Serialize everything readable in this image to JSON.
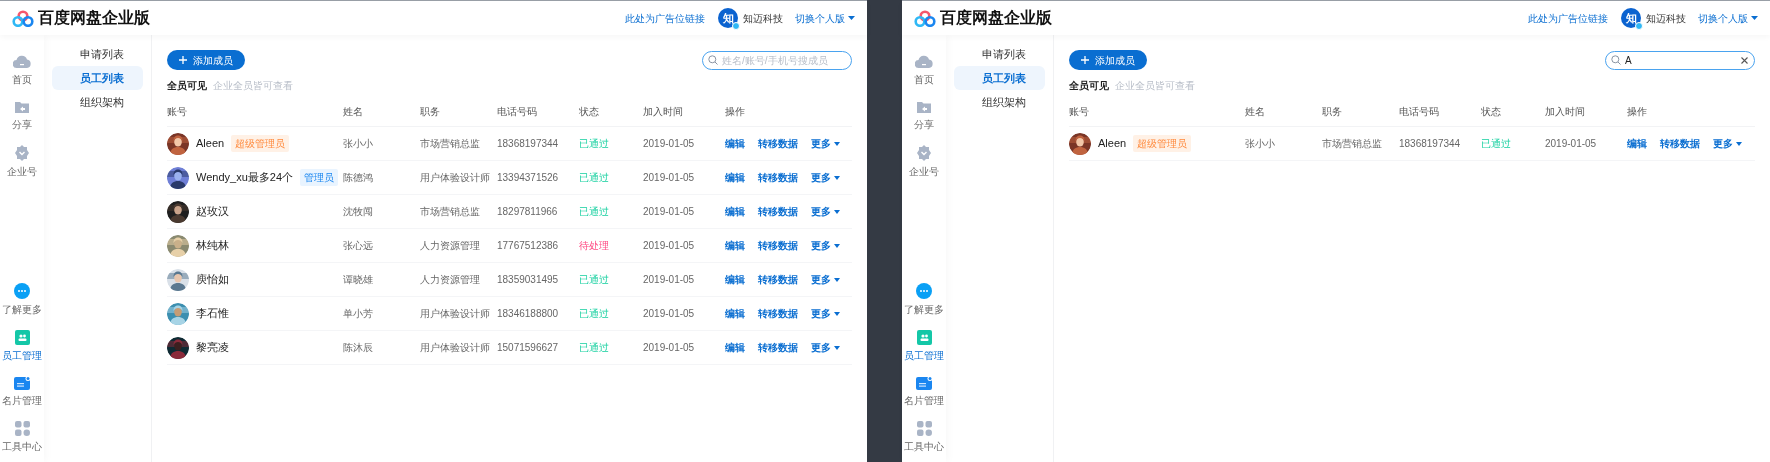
{
  "screens": [
    {
      "logo_text": "百度网盘企业版",
      "ad_link": "此处为广告位链接",
      "company_avatar": "知",
      "company_name": "知迈科技",
      "switch_label": "切换个人版",
      "rail_top": [
        {
          "kind": "home",
          "label": "首页",
          "selected": false
        },
        {
          "kind": "share",
          "label": "分享",
          "selected": false
        },
        {
          "kind": "enterprise",
          "label": "企业号",
          "selected": false
        }
      ],
      "rail_bottom": [
        {
          "kind": "more",
          "label": "了解更多",
          "selected": false
        },
        {
          "kind": "staff",
          "label": "员工管理",
          "selected": true
        },
        {
          "kind": "card",
          "label": "名片管理",
          "selected": false
        },
        {
          "kind": "tools",
          "label": "工具中心",
          "selected": false
        }
      ],
      "subnav": [
        {
          "label": "申请列表",
          "selected": false
        },
        {
          "label": "员工列表",
          "selected": true
        },
        {
          "label": "组织架构",
          "selected": false
        }
      ],
      "add_button": "添加成员",
      "visibility": "全员可见",
      "visibility_hint": "企业全员皆可查看",
      "search": {
        "placeholder": "姓名/账号/手机号搜成员"
      },
      "columns": [
        "账号",
        "姓名",
        "职务",
        "电话号码",
        "状态",
        "加入时间",
        "操作"
      ],
      "rows": [
        {
          "account": "Aleen",
          "badge": {
            "kind": "super",
            "label": "超级管理员"
          },
          "name": "张小小",
          "title": "市场营销总监",
          "phone": "18368197344",
          "status": {
            "kind": "approved",
            "label": "已通过"
          },
          "date": "2019-01-05",
          "actions": [
            "编辑",
            "转移数据",
            "更多"
          ]
        },
        {
          "account": "Wendy_xu最多24个",
          "badge": {
            "kind": "admin",
            "label": "管理员"
          },
          "name": "陈德鸿",
          "title": "用户体验设计师",
          "phone": "13394371526",
          "status": {
            "kind": "approved",
            "label": "已通过"
          },
          "date": "2019-01-05",
          "actions": [
            "编辑",
            "转移数据",
            "更多"
          ]
        },
        {
          "account": "赵玫汉",
          "name": "沈牧闯",
          "title": "市场营销总监",
          "phone": "18297811966",
          "status": {
            "kind": "approved",
            "label": "已通过"
          },
          "date": "2019-01-05",
          "actions": [
            "编辑",
            "转移数据",
            "更多"
          ]
        },
        {
          "account": "林纯林",
          "name": "张心远",
          "title": "人力资源管理",
          "phone": "17767512386",
          "status": {
            "kind": "pending",
            "label": "待处理"
          },
          "date": "2019-01-05",
          "actions": [
            "编辑",
            "转移数据",
            "更多"
          ]
        },
        {
          "account": "庾怡如",
          "name": "谭晓雄",
          "title": "人力资源管理",
          "phone": "18359031495",
          "status": {
            "kind": "approved",
            "label": "已通过"
          },
          "date": "2019-01-05",
          "actions": [
            "编辑",
            "转移数据",
            "更多"
          ]
        },
        {
          "account": "李石惟",
          "name": "单小芳",
          "title": "用户体验设计师",
          "phone": "18346188800",
          "status": {
            "kind": "approved",
            "label": "已通过"
          },
          "date": "2019-01-05",
          "actions": [
            "编辑",
            "转移数据",
            "更多"
          ]
        },
        {
          "account": "黎亮凌",
          "name": "陈沐辰",
          "title": "用户体验设计师",
          "phone": "15071596627",
          "status": {
            "kind": "approved",
            "label": "已通过"
          },
          "date": "2019-01-05",
          "actions": [
            "编辑",
            "转移数据",
            "更多"
          ]
        }
      ]
    },
    {
      "logo_text": "百度网盘企业版",
      "ad_link": "此处为广告位链接",
      "company_avatar": "知",
      "company_name": "知迈科技",
      "switch_label": "切换个人版",
      "rail_top": [
        {
          "kind": "home",
          "label": "首页",
          "selected": false
        },
        {
          "kind": "share",
          "label": "分享",
          "selected": false
        },
        {
          "kind": "enterprise",
          "label": "企业号",
          "selected": false
        }
      ],
      "rail_bottom": [
        {
          "kind": "more",
          "label": "了解更多",
          "selected": false
        },
        {
          "kind": "staff",
          "label": "员工管理",
          "selected": true
        },
        {
          "kind": "card",
          "label": "名片管理",
          "selected": false
        },
        {
          "kind": "tools",
          "label": "工具中心",
          "selected": false
        }
      ],
      "subnav": [
        {
          "label": "申请列表",
          "selected": false
        },
        {
          "label": "员工列表",
          "selected": true
        },
        {
          "label": "组织架构",
          "selected": false
        }
      ],
      "add_button": "添加成员",
      "visibility": "全员可见",
      "visibility_hint": "企业全员皆可查看",
      "search": {
        "value": "A"
      },
      "columns": [
        "账号",
        "姓名",
        "职务",
        "电话号码",
        "状态",
        "加入时间",
        "操作"
      ],
      "rows": [
        {
          "account": "Aleen",
          "badge": {
            "kind": "super",
            "label": "超级管理员"
          },
          "name": "张小小",
          "title": "市场营销总监",
          "phone": "18368197344",
          "status": {
            "kind": "approved",
            "label": "已通过"
          },
          "date": "2019-01-05",
          "actions": [
            "编辑",
            "转移数据",
            "更多"
          ]
        }
      ]
    }
  ]
}
